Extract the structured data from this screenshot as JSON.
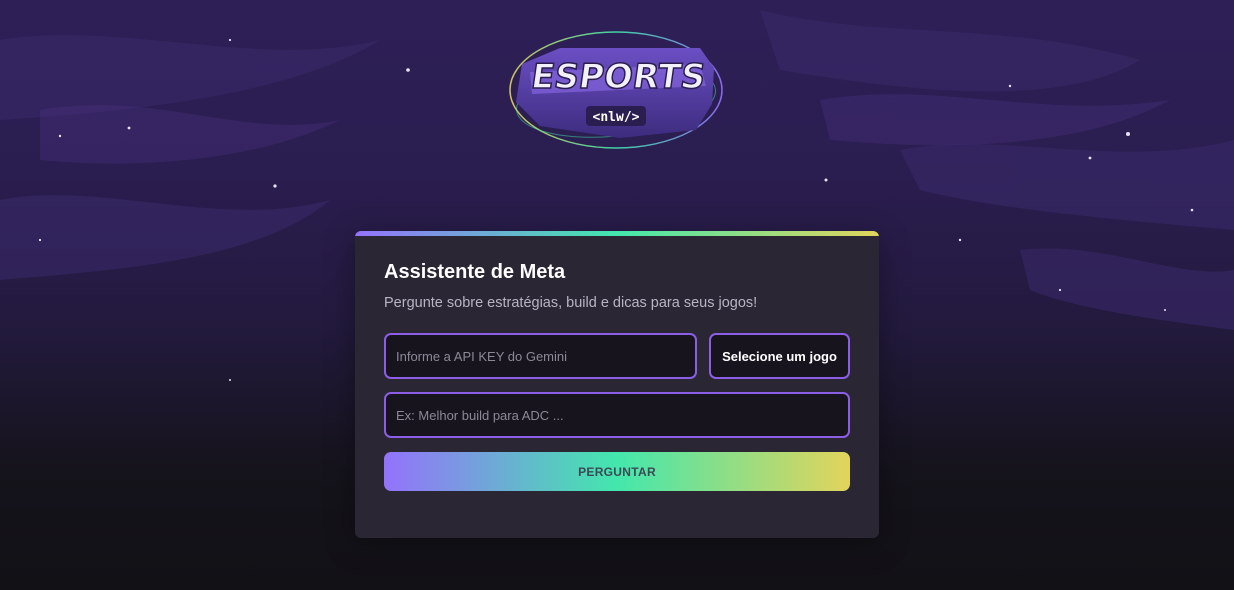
{
  "logo": {
    "wordmark": "ESPORTS",
    "tag": "<nlw/>"
  },
  "card": {
    "title": "Assistente de Meta",
    "subtitle": "Pergunte sobre estratégias, build e dicas para seus jogos!",
    "api_key_placeholder": "Informe a API KEY do Gemini",
    "game_select_value": "Selecione um jogo",
    "question_placeholder": "Ex: Melhor build para ADC ...",
    "ask_button_label": "PERGUNTAR"
  },
  "colors": {
    "accent_purple": "#9572fc",
    "accent_green": "#43e7ad",
    "accent_yellow": "#e2d45c",
    "card_background": "#2a2634",
    "input_border": "#8c5ee6"
  }
}
